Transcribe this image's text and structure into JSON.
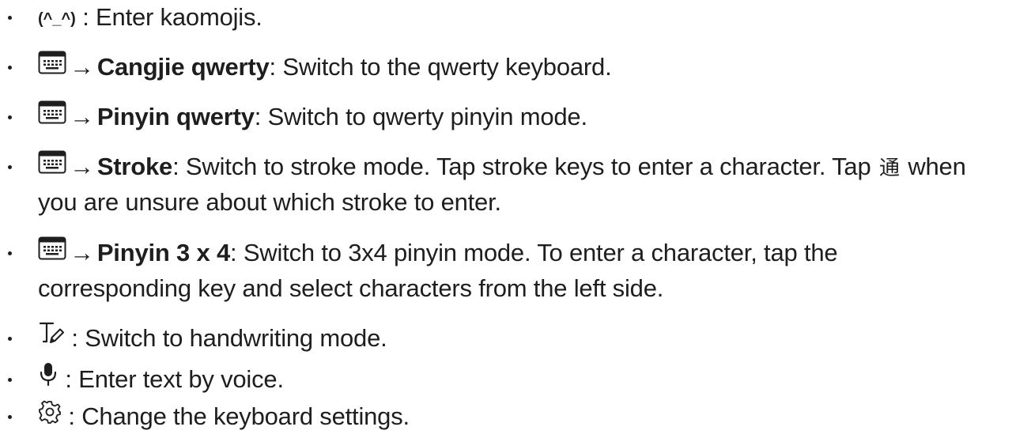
{
  "items": [
    {
      "icon": "kaomoji-icon",
      "icon_text": "(^_^)",
      "text": " : Enter kaomojis."
    },
    {
      "icon": "keyboard-icon",
      "arrow": "→",
      "bold": "Cangjie qwerty",
      "text": ": Switch to the qwerty keyboard."
    },
    {
      "icon": "keyboard-icon",
      "arrow": "→",
      "bold": "Pinyin qwerty",
      "text": ": Switch to qwerty pinyin mode."
    },
    {
      "icon": "keyboard-icon",
      "arrow": "→",
      "bold": "Stroke",
      "text": ": Switch to stroke mode. Tap stroke keys to enter a character. Tap ",
      "cjk": "通",
      "text_after": " when",
      "cont": "you are unsure about which stroke to enter."
    },
    {
      "icon": "keyboard-icon",
      "arrow": "→",
      "bold": "Pinyin 3 x 4",
      "text": ": Switch to 3x4 pinyin mode. To enter a character, tap the",
      "cont": "corresponding key and select characters from the left side."
    },
    {
      "icon": "handwriting-icon",
      "text": " : Switch to handwriting mode."
    },
    {
      "icon": "microphone-icon",
      "text": " : Enter text by voice."
    },
    {
      "icon": "gear-icon",
      "text": " : Change the keyboard settings."
    }
  ]
}
